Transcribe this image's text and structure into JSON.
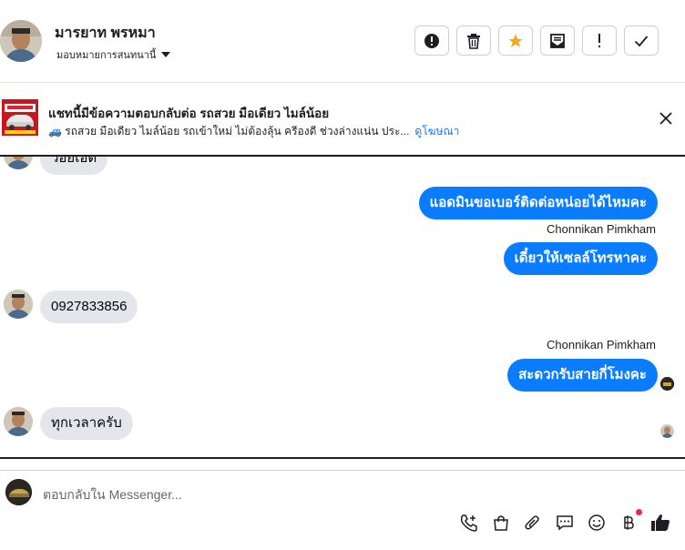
{
  "header": {
    "contact_name": "มารยาท พรหมา",
    "assign_label": "มอบหมายการสนทนานี้"
  },
  "actions": [
    {
      "name": "spam-button",
      "icon": "alert-circle-icon"
    },
    {
      "name": "delete-button",
      "icon": "trash-icon"
    },
    {
      "name": "star-button",
      "icon": "star-icon",
      "color": "#f5a623"
    },
    {
      "name": "mark-unread-button",
      "icon": "envelope-icon"
    },
    {
      "name": "follow-up-button",
      "icon": "exclamation-icon"
    },
    {
      "name": "done-button",
      "icon": "check-icon"
    }
  ],
  "ad_banner": {
    "title": "แชทนี้มีข้อความตอบกลับต่อ รถสวย มือเดียว ไมล์น้อย",
    "subtitle": "🚙 รถสวย มือเดียว ไมล์น้อย รถเข้าใหม่ ไม่ต้องลุ้น ครีองดี ช่วงล่างแน่น ประ...",
    "link": "ดูโฆษณา"
  },
  "messages": [
    {
      "dir": "in",
      "text": "ว่อยเอ็ต",
      "partial": true
    },
    {
      "dir": "out",
      "text": "แอดมินขอเบอร์ติดต่อหน่อยได้ไหมคะ"
    },
    {
      "dir": "out",
      "sender": "Chonnikan Pimkham",
      "text": "เดี๋ยวให้เซลล์โทรหาคะ"
    },
    {
      "dir": "in",
      "text": "0927833856"
    },
    {
      "dir": "out",
      "sender": "Chonnikan Pimkham",
      "text": "สะดวกรับสายกี่โมงคะ"
    },
    {
      "dir": "in",
      "text": "ทุกเวลาครับ"
    }
  ],
  "composer": {
    "placeholder": "ตอบกลับใน Messenger..."
  },
  "tools": [
    "phone-plus-icon",
    "shopping-bag-icon",
    "paperclip-icon",
    "chat-bubble-icon",
    "smiley-icon",
    "baht-icon",
    "thumbs-up-icon"
  ],
  "colors": {
    "accent": "#0a7cff",
    "incoming": "#e4e6eb",
    "notify": "#f02849"
  }
}
